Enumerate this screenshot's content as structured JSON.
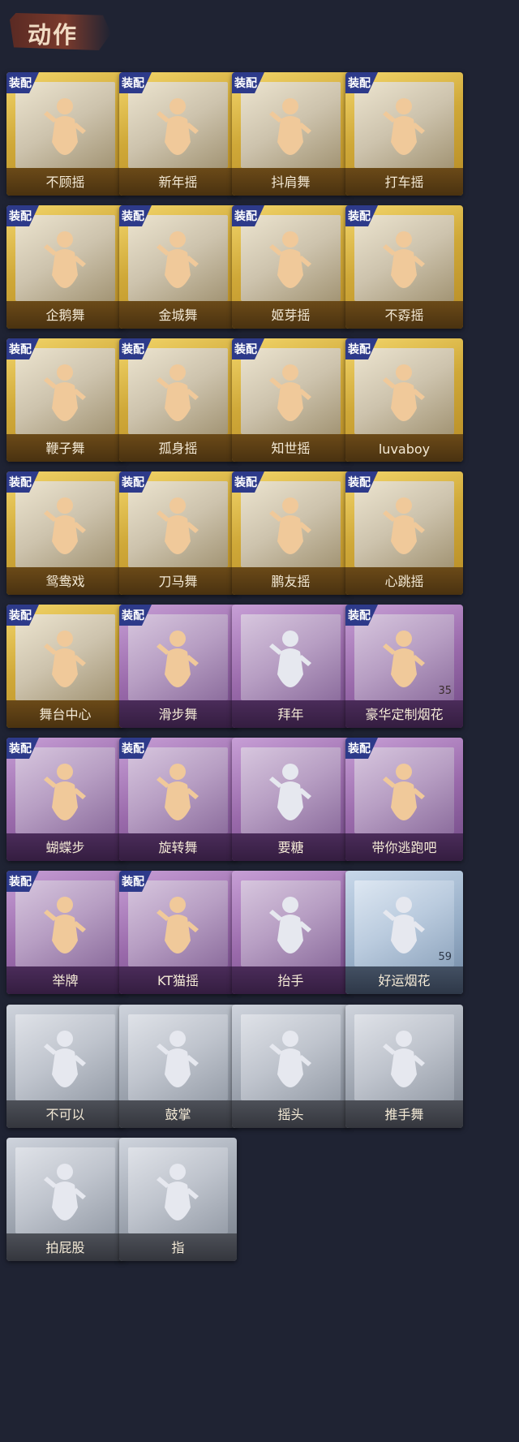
{
  "section_title": "动作",
  "equip_label": "装配",
  "cards": [
    {
      "name": "不顾摇",
      "tier": "gold",
      "equipped": true
    },
    {
      "name": "新年摇",
      "tier": "gold",
      "equipped": true
    },
    {
      "name": "抖肩舞",
      "tier": "gold",
      "equipped": true
    },
    {
      "name": "打车摇",
      "tier": "gold",
      "equipped": true
    },
    {
      "name": "企鹅舞",
      "tier": "gold",
      "equipped": true
    },
    {
      "name": "金城舞",
      "tier": "gold",
      "equipped": true
    },
    {
      "name": "姬芽摇",
      "tier": "gold",
      "equipped": true
    },
    {
      "name": "不孬摇",
      "tier": "gold",
      "equipped": true
    },
    {
      "name": "鞭子舞",
      "tier": "gold",
      "equipped": true
    },
    {
      "name": "孤身摇",
      "tier": "gold",
      "equipped": true
    },
    {
      "name": "知世摇",
      "tier": "gold",
      "equipped": true
    },
    {
      "name": "luvaboy",
      "tier": "gold",
      "equipped": true
    },
    {
      "name": "鸳鸯戏",
      "tier": "gold",
      "equipped": true
    },
    {
      "name": "刀马舞",
      "tier": "gold",
      "equipped": true
    },
    {
      "name": "鹏友摇",
      "tier": "gold",
      "equipped": true
    },
    {
      "name": "心跳摇",
      "tier": "gold",
      "equipped": true
    },
    {
      "name": "舞台中心",
      "tier": "gold",
      "equipped": true
    },
    {
      "name": "滑步舞",
      "tier": "purple",
      "equipped": true
    },
    {
      "name": "拜年",
      "tier": "purple",
      "equipped": false
    },
    {
      "name": "豪华定制烟花",
      "tier": "purple",
      "equipped": true,
      "count": "35"
    },
    {
      "name": "蝴蝶步",
      "tier": "purple",
      "equipped": true
    },
    {
      "name": "旋转舞",
      "tier": "purple",
      "equipped": true
    },
    {
      "name": "要糖",
      "tier": "purple",
      "equipped": false
    },
    {
      "name": "带你逃跑吧",
      "tier": "purple",
      "equipped": true
    },
    {
      "name": "举牌",
      "tier": "purple",
      "equipped": true
    },
    {
      "name": "KT猫摇",
      "tier": "purple",
      "equipped": true
    },
    {
      "name": "抬手",
      "tier": "purple",
      "equipped": false
    },
    {
      "name": "好运烟花",
      "tier": "blue",
      "equipped": false,
      "count": "59"
    },
    {
      "name": "不可以",
      "tier": "silver",
      "equipped": false
    },
    {
      "name": "鼓掌",
      "tier": "silver",
      "equipped": false
    },
    {
      "name": "摇头",
      "tier": "silver",
      "equipped": false
    },
    {
      "name": "推手舞",
      "tier": "silver",
      "equipped": false
    },
    {
      "name": "拍屁股",
      "tier": "silver",
      "equipped": false
    },
    {
      "name": "指",
      "tier": "silver",
      "equipped": false
    }
  ],
  "colors": {
    "page_bg": "#1f2333",
    "equip_badge": "#2d3a8a",
    "figure_gold": "#f0c99a",
    "figure_silver": "#e6e8ef"
  }
}
